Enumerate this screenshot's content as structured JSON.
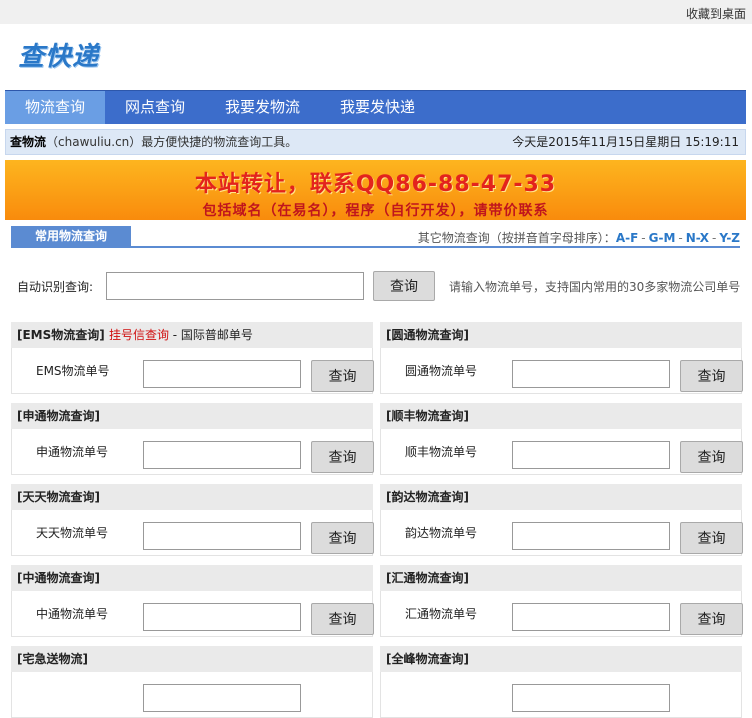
{
  "top": {
    "favorite_label": "收藏到桌面"
  },
  "logo": {
    "text": "查快递"
  },
  "nav": [
    "物流查询",
    "网点查询",
    "我要发物流",
    "我要发快递"
  ],
  "info": {
    "site_name": "查物流",
    "site_desc": "（chawuliu.cn）最方便快捷的物流查询工具。",
    "today": "今天是2015年11月15日星期日  15:19:11"
  },
  "banner": {
    "line1": "本站转让，联系QQ86-88-47-33",
    "line2": "包括域名（在易名），程序（自行开发），请带价联系"
  },
  "tabs": {
    "common": "常用物流查询",
    "other_prefix": "其它物流查询（按拼音首字母排序）：",
    "ranges": [
      "A-F",
      "G-M",
      "N-X",
      "Y-Z"
    ]
  },
  "auto": {
    "label": "自动识别查询:",
    "button": "查询",
    "hint": "请输入物流单号，支持国内常用的30多家物流公司单号"
  },
  "carriers": [
    {
      "title": "[EMS物流查询]",
      "extra_red": "挂号信查询",
      "extra": " - 国际普邮单号",
      "field": "EMS物流单号",
      "button": "查询"
    },
    {
      "title": "[圆通物流查询]",
      "field": "圆通物流单号",
      "button": "查询"
    },
    {
      "title": "[申通物流查询]",
      "field": "申通物流单号",
      "button": "查询"
    },
    {
      "title": "[顺丰物流查询]",
      "field": "顺丰物流单号",
      "button": "查询"
    },
    {
      "title": "[天天物流查询]",
      "field": "天天物流单号",
      "button": "查询"
    },
    {
      "title": "[韵达物流查询]",
      "field": "韵达物流单号",
      "button": "查询"
    },
    {
      "title": "[中通物流查询]",
      "field": "中通物流单号",
      "button": "查询"
    },
    {
      "title": "[汇通物流查询]",
      "field": "汇通物流单号",
      "button": "查询"
    },
    {
      "title": "[宅急送物流]"
    },
    {
      "title": "[全峰物流查询]"
    }
  ]
}
